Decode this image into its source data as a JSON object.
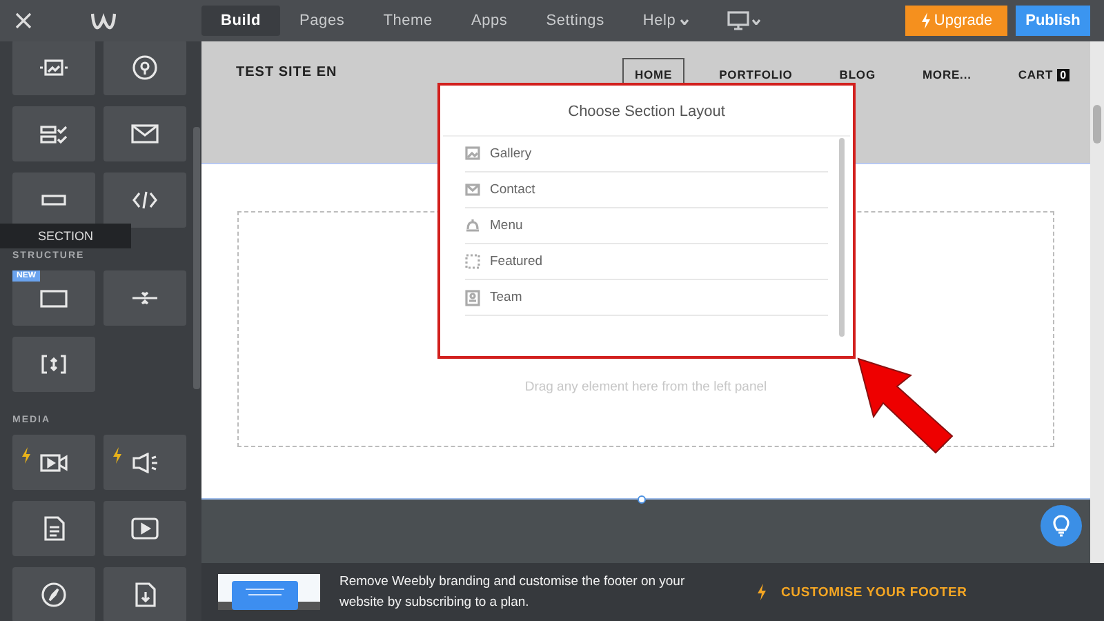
{
  "topbar": {
    "tabs": [
      {
        "label": "Build",
        "selected": true,
        "dropdown": false
      },
      {
        "label": "Pages",
        "selected": false,
        "dropdown": false
      },
      {
        "label": "Theme",
        "selected": false,
        "dropdown": false
      },
      {
        "label": "Apps",
        "selected": false,
        "dropdown": false
      },
      {
        "label": "Settings",
        "selected": false,
        "dropdown": false
      },
      {
        "label": "Help",
        "selected": false,
        "dropdown": true
      }
    ],
    "upgrade": "Upgrade",
    "publish": "Publish"
  },
  "sidebar": {
    "groups": [
      {
        "tiles": [
          {
            "premium": false
          },
          {
            "premium": false
          },
          {
            "premium": false
          },
          {
            "premium": false
          },
          {
            "premium": false
          },
          {
            "premium": false
          }
        ]
      },
      {
        "label": "STRUCTURE",
        "tiles": [
          {
            "premium": false,
            "badge": "NEW"
          },
          {
            "premium": false
          },
          {
            "premium": false
          }
        ]
      },
      {
        "label": "MEDIA",
        "tiles": [
          {
            "premium": true
          },
          {
            "premium": true
          },
          {
            "premium": false
          },
          {
            "premium": false
          },
          {
            "premium": false
          },
          {
            "premium": false
          }
        ]
      }
    ],
    "tooltip": "SECTION"
  },
  "site": {
    "title": "TEST SITE EN",
    "nav": [
      {
        "label": "HOME",
        "selected": true
      },
      {
        "label": "PORTFOLIO",
        "selected": false
      },
      {
        "label": "BLOG",
        "selected": false
      },
      {
        "label": "MORE...",
        "selected": false
      },
      {
        "label": "CART",
        "selected": false,
        "count": "0"
      }
    ],
    "drop_hint": "Drag any element here from the left panel"
  },
  "popup": {
    "title": "Choose Section Layout",
    "items": [
      {
        "label": "Gallery"
      },
      {
        "label": "Contact"
      },
      {
        "label": "Menu"
      },
      {
        "label": "Featured"
      },
      {
        "label": "Team"
      }
    ]
  },
  "promo": {
    "text": "Remove Weebly branding and customise the footer on your website by subscribing to a plan.",
    "link": "CUSTOMISE YOUR FOOTER"
  }
}
